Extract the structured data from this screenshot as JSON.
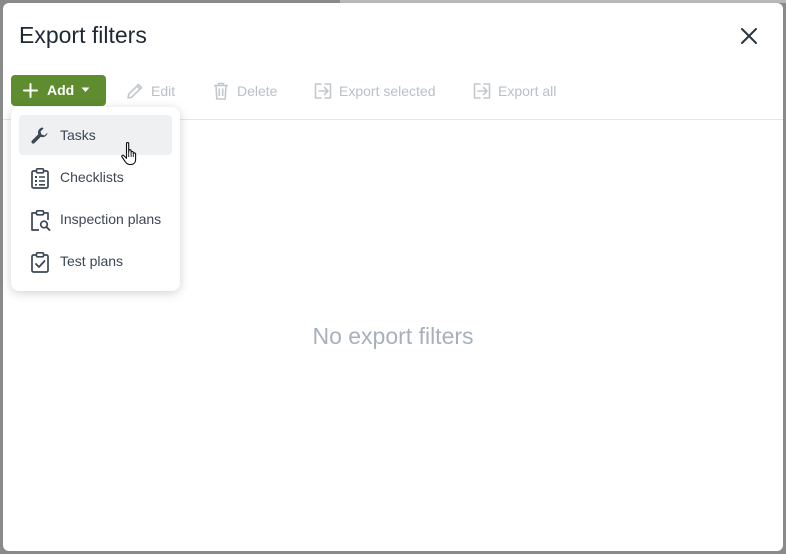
{
  "dialog": {
    "title": "Export filters",
    "close_icon": "close-icon"
  },
  "toolbar": {
    "add": {
      "label": "Add",
      "icon": "plus-icon",
      "caret_icon": "caret-down-icon",
      "color": "#5e8c2f"
    },
    "edit": {
      "label": "Edit",
      "icon": "pencil-icon"
    },
    "delete": {
      "label": "Delete",
      "icon": "trash-icon"
    },
    "export_selected": {
      "label": "Export selected",
      "icon": "export-icon"
    },
    "export_all": {
      "label": "Export all",
      "icon": "export-icon"
    }
  },
  "add_menu": {
    "items": [
      {
        "label": "Tasks",
        "icon": "wrench-icon",
        "hovered": true
      },
      {
        "label": "Checklists",
        "icon": "clipboard-list-icon"
      },
      {
        "label": "Inspection plans",
        "icon": "clipboard-search-icon"
      },
      {
        "label": "Test plans",
        "icon": "clipboard-check-icon"
      }
    ]
  },
  "empty_state": {
    "message": "No export filters"
  },
  "colors": {
    "disabled_text": "#b9c0c7",
    "title_text": "#1f2933",
    "empty_text": "#a8b1ba"
  }
}
